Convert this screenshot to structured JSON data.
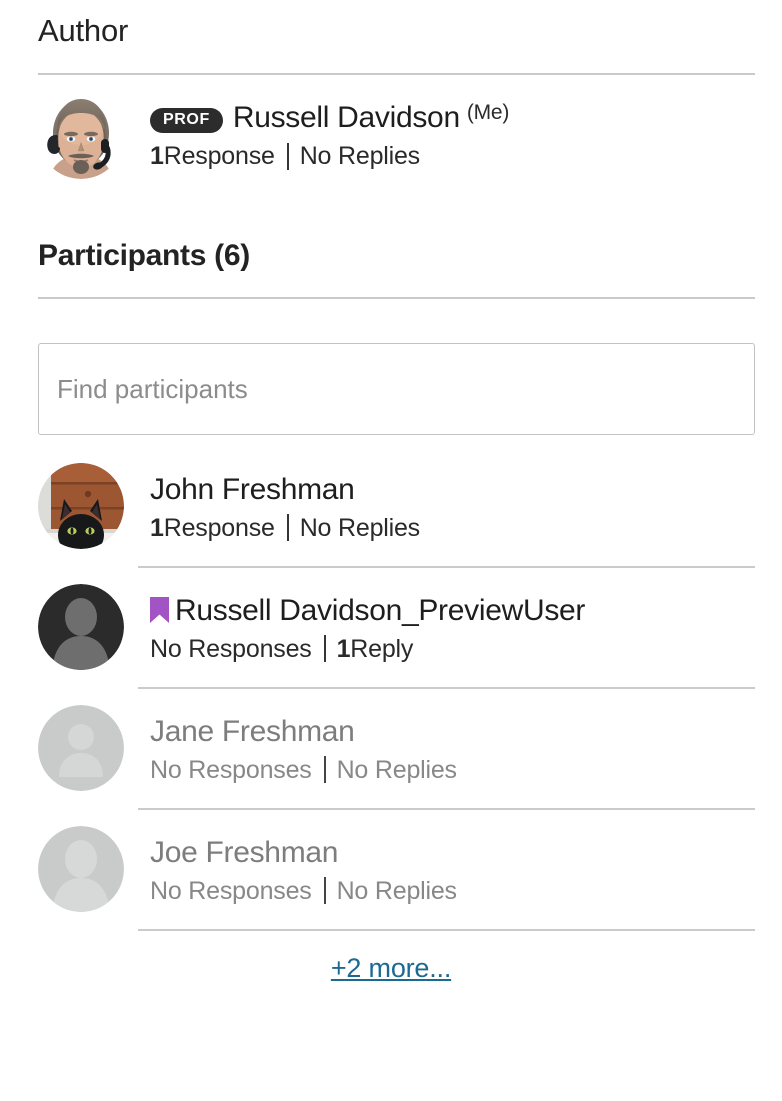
{
  "author_section": {
    "heading": "Author",
    "person": {
      "avatar_name": "avatar-photo-man-headset",
      "role_badge": "PROF",
      "name": "Russell Davidson",
      "me_tag": "(Me)",
      "responses_count": "1",
      "responses_label": " Response",
      "replies_text": "No Replies"
    }
  },
  "participants_section": {
    "heading": "Participants (6)",
    "search": {
      "placeholder": "Find participants",
      "value": ""
    },
    "items": [
      {
        "avatar_name": "avatar-photo-cat",
        "name": "John Freshman",
        "has_bookmark": false,
        "muted": false,
        "responses_count": "1",
        "responses_label": " Response",
        "replies_text": "No Replies"
      },
      {
        "avatar_name": "avatar-silhouette-dark",
        "name": "Russell Davidson_PreviewUser",
        "has_bookmark": true,
        "bookmark_icon": "bookmark-icon",
        "muted": false,
        "responses_count": "",
        "responses_label": "No Responses",
        "replies_count": "1",
        "replies_text": " Reply"
      },
      {
        "avatar_name": "avatar-silhouette-light-person",
        "name": "Jane Freshman",
        "has_bookmark": false,
        "muted": true,
        "responses_count": "",
        "responses_label": "No Responses",
        "replies_text": "No Replies"
      },
      {
        "avatar_name": "avatar-silhouette-light-head",
        "name": "Joe Freshman",
        "has_bookmark": false,
        "muted": true,
        "responses_count": "",
        "responses_label": "No Responses",
        "replies_text": "No Replies"
      }
    ],
    "more_link": "+2 more..."
  },
  "colors": {
    "badge_bg": "#2c2c2c",
    "bookmark_purple": "#a253c4",
    "link_blue": "#1c6a94",
    "rule_gray": "#c9c9c9",
    "muted_text": "#888888",
    "avatar_dark_bg": "#2b2b2b",
    "avatar_light_bg": "#c9cbcb"
  }
}
